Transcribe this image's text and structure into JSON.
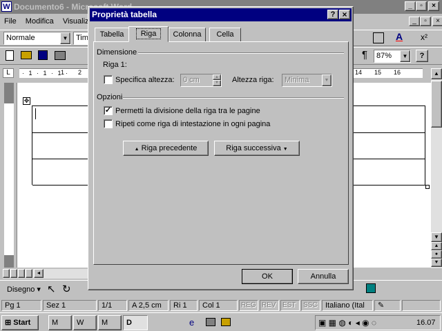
{
  "word": {
    "title": "Documento6 - Microsoft Word",
    "menu": [
      "File",
      "Modifica",
      "Visualizza"
    ],
    "style_combo": "Normale",
    "font_combo": "Tim",
    "zoom": "87%",
    "drawing_label": "Disegno",
    "ruler_numbers_left": [
      "1",
      "2"
    ],
    "ruler_numbers_right": [
      "14",
      "15",
      "16"
    ]
  },
  "dialog": {
    "title": "Proprietà tabella",
    "tabs": [
      "Tabella",
      "Riga",
      "Colonna",
      "Cella"
    ],
    "active_tab": "Riga",
    "section_dimension": "Dimensione",
    "row_label": "Riga 1:",
    "specify_height_label": "Specifica altezza:",
    "specify_height_checked": false,
    "height_value": "0 cm",
    "row_height_label": "Altezza riga:",
    "row_height_value": "Minima",
    "section_options": "Opzioni",
    "allow_break_label": "Permetti la divisione della riga tra le pagine",
    "allow_break_checked": true,
    "repeat_header_label": "Ripeti come riga di intestazione in ogni pagina",
    "repeat_header_checked": false,
    "prev_row_button": "Riga precedente",
    "next_row_button": "Riga successiva",
    "ok_button": "OK",
    "cancel_button": "Annulla",
    "help_glyph": "?",
    "close_glyph": "×"
  },
  "status": {
    "page": "Pg 1",
    "section": "Sez 1",
    "pages": "1/1",
    "at": "A 2,5 cm",
    "line": "Ri 1",
    "col": "Col 1",
    "reg": "REG",
    "rev": "REV",
    "est": "EST",
    "ssc": "SSC",
    "language": "Italiano (Ital"
  },
  "taskbar": {
    "start": "Start",
    "tasks": [
      "M",
      "W",
      "M",
      "D"
    ],
    "clock": "16.07"
  },
  "colors": {
    "title_active": "#000080",
    "title_inactive": "#808080",
    "face": "#c0c0c0"
  }
}
